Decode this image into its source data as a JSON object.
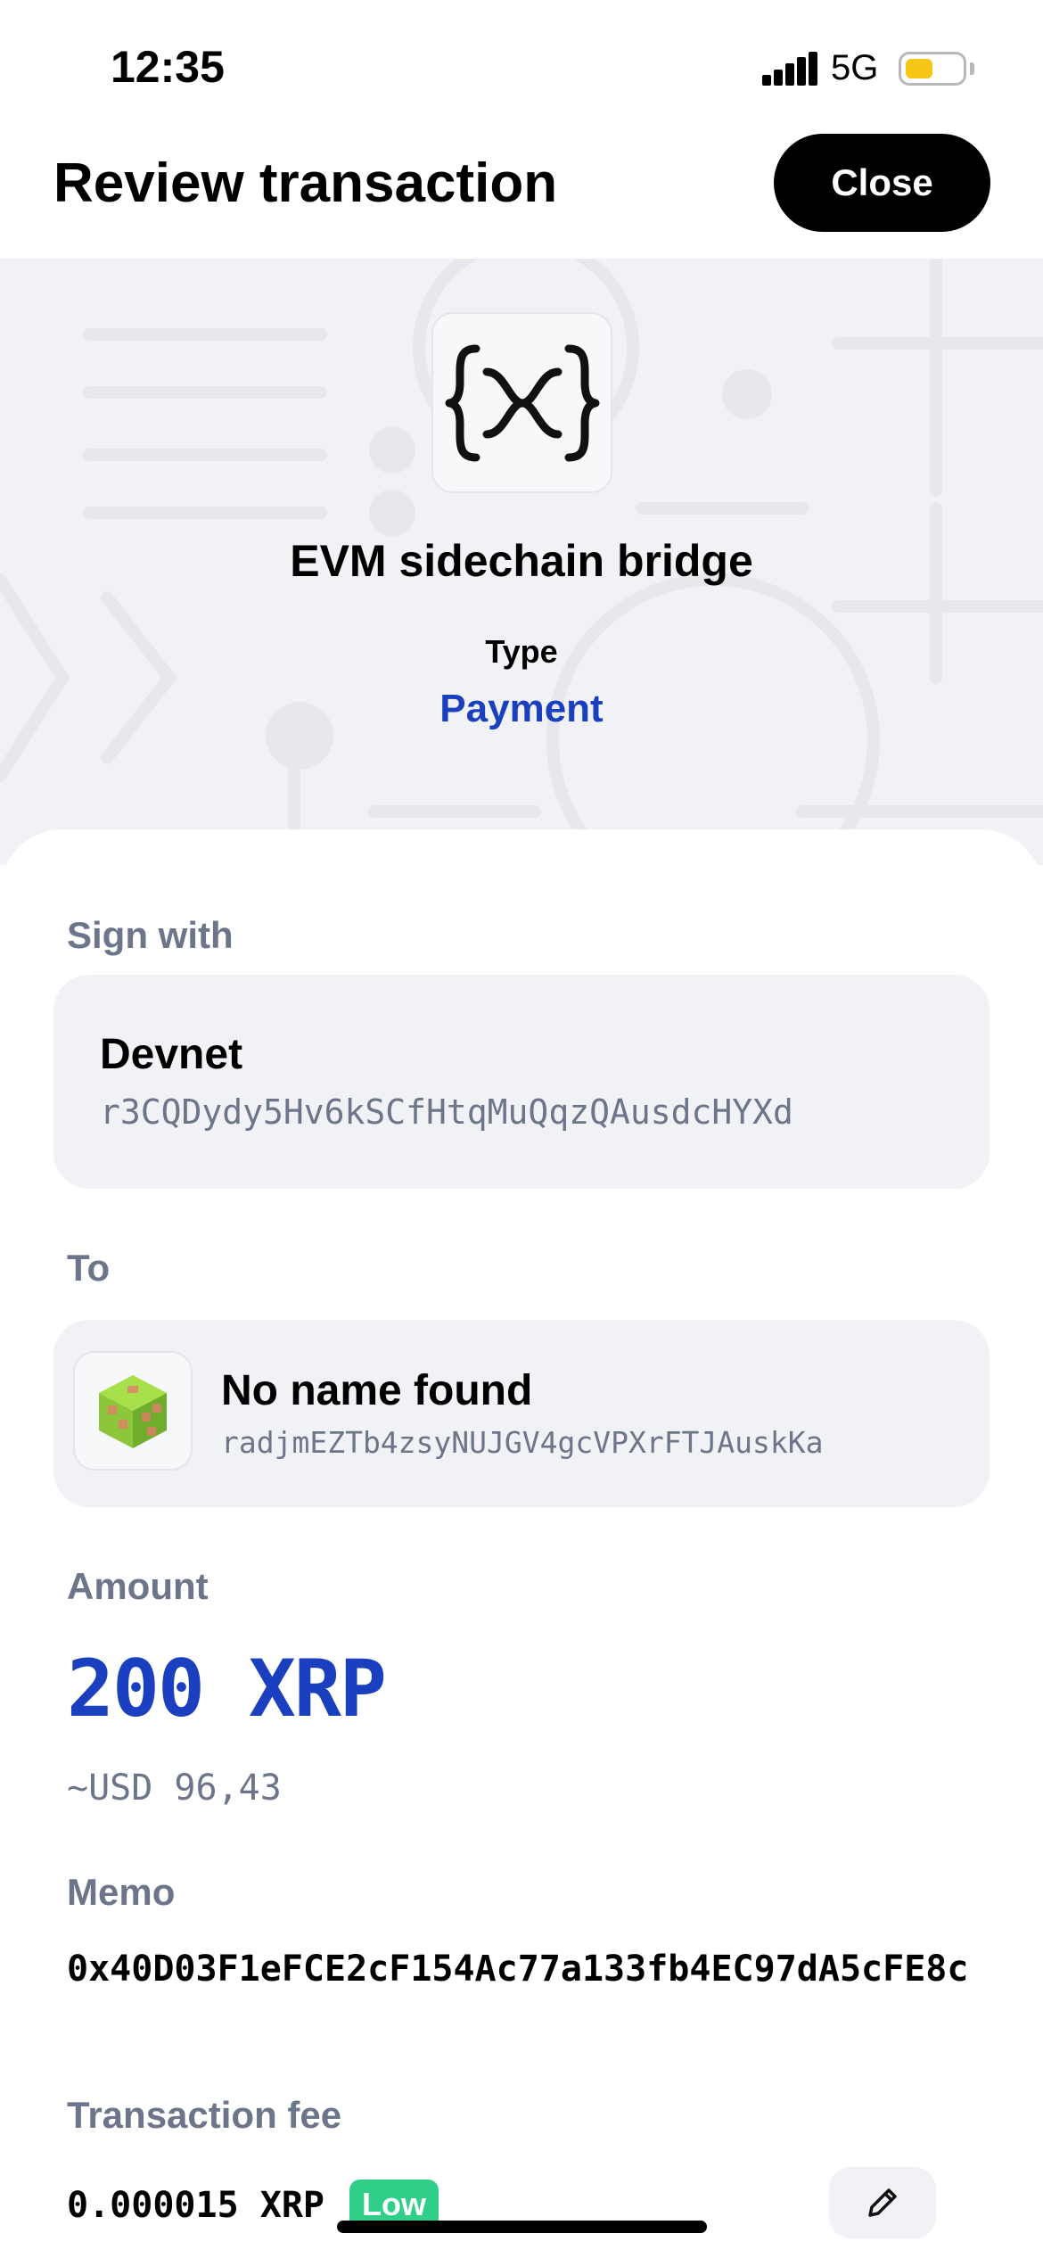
{
  "status_bar": {
    "time": "12:35",
    "network": "5G",
    "battery_color": "#f6c515",
    "icons": [
      "signal-icon",
      "battery-icon"
    ]
  },
  "header": {
    "title": "Review transaction",
    "close_label": "Close"
  },
  "hero": {
    "app_icon": "xrpl-evm-bridge-icon",
    "app_name": "EVM sidechain bridge",
    "type_label": "Type",
    "type_value": "Payment"
  },
  "sign_with": {
    "label": "Sign with",
    "account_name": "Devnet",
    "address": "r3CQDydy5Hv6kSCfHtqMuQqzQAusdcHYXd"
  },
  "to": {
    "label": "To",
    "name": "No name found",
    "address": "radjmEZTb4zsyNUJGV4gcVPXrFTJAuskKa",
    "avatar_icon": "identicon-cube-icon"
  },
  "amount": {
    "label": "Amount",
    "value": "200 XRP",
    "fiat": "~USD 96,43"
  },
  "memo": {
    "label": "Memo",
    "value": "0x40D03F1eFCE2cF154Ac77a133fb4EC97dA5cFE8c"
  },
  "fee": {
    "label": "Transaction fee",
    "value": "0.000015 XRP",
    "badge": "Low",
    "badge_color": "#2fcf8a",
    "edit_icon": "pencil-icon"
  },
  "colors": {
    "accent": "#1a3fbf",
    "muted": "#6c7589",
    "card_bg": "#f1f2f5"
  }
}
